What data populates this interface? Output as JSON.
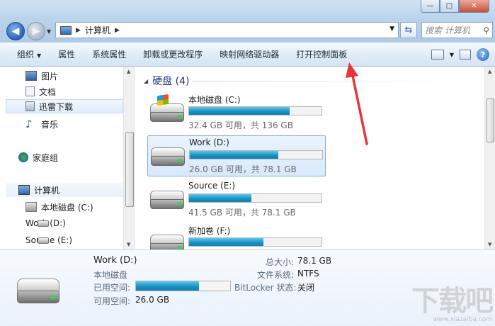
{
  "window": {
    "min_glyph": "—",
    "max_glyph": "□",
    "close_glyph": "✕"
  },
  "address": {
    "segment": "计算机",
    "placeholder": "搜索 计算机"
  },
  "toolbar": {
    "organize": "组织",
    "properties": "属性",
    "system_properties": "系统属性",
    "uninstall": "卸载或更改程序",
    "map_drive": "映射网络驱动器",
    "control_panel": "打开控制面板"
  },
  "nav": {
    "items": [
      {
        "label": "图片",
        "icon": "pictures-icon"
      },
      {
        "label": "文档",
        "icon": "documents-icon"
      },
      {
        "label": "迅雷下载",
        "icon": "downloads-icon"
      },
      {
        "label": "音乐",
        "icon": "music-icon"
      },
      {
        "label": "家庭组",
        "icon": "homegroup-icon"
      },
      {
        "label": "计算机",
        "icon": "computer-icon"
      },
      {
        "label": "本地磁盘 (C:)",
        "icon": "system-drive-icon"
      },
      {
        "label": "Work (D:)",
        "icon": "drive-icon"
      },
      {
        "label": "Source (E:)",
        "icon": "drive-icon"
      }
    ]
  },
  "content": {
    "group_title": "硬盘 (4)",
    "drives": [
      {
        "name": "本地磁盘 (C:)",
        "free_text": "32.4 GB 可用，共 136 GB",
        "used_fraction": 0.762,
        "selected": false
      },
      {
        "name": "Work (D:)",
        "free_text": "26.0 GB 可用，共 78.1 GB",
        "used_fraction": 0.667,
        "selected": true
      },
      {
        "name": "Source (E:)",
        "free_text": "41.5 GB 可用，共 78.1 GB",
        "used_fraction": 0.469,
        "selected": false
      },
      {
        "name": "新加卷 (F:)",
        "free_text": "",
        "used_fraction": 0.56,
        "selected": false
      }
    ]
  },
  "details": {
    "title": "Work (D:)",
    "type": "本地磁盘",
    "used_label": "已用空间:",
    "free_label": "可用空间:",
    "free_value": "26.0 GB",
    "total_label": "总大小:",
    "total_value": "78.1 GB",
    "fs_label": "文件系统:",
    "fs_value": "NTFS",
    "bitlocker_label": "BitLocker 状态:",
    "bitlocker_value": "关闭",
    "used_fraction": 0.667
  },
  "watermark": {
    "text": "下载吧",
    "url": "www.xiazaiba.com"
  },
  "colors": {
    "accent": "#1e3287",
    "bar_fill": "#1a92c2",
    "annotation_arrow": "#e8353a"
  }
}
